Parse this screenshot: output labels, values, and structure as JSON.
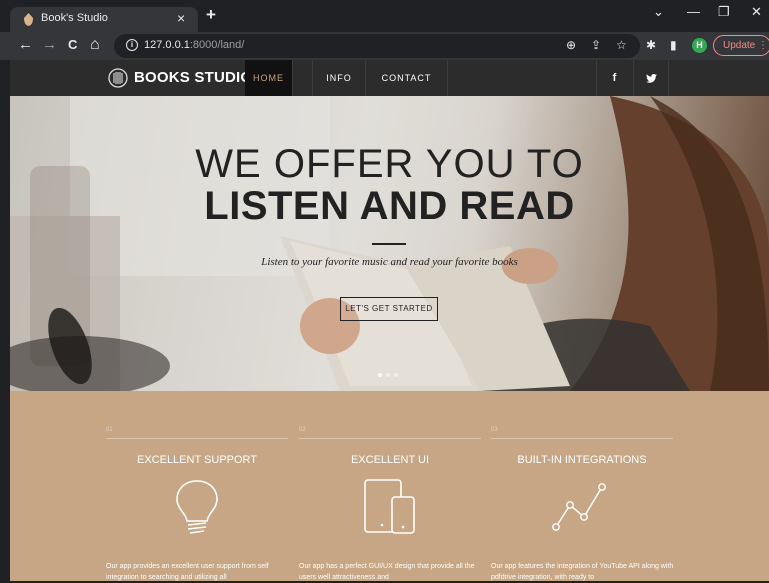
{
  "browser": {
    "tab_title": "Book's Studio",
    "tab_close": "×",
    "new_tab": "+",
    "url_host": "127.0.0.1",
    "url_path": ":8000/land/",
    "update_label": "Update",
    "update_menu": "⋮",
    "profile_initial": "H",
    "window_controls": {
      "dropdown": "⌄",
      "minimize": "—",
      "restore": "❐",
      "close": "✕"
    },
    "nav": {
      "back": "←",
      "forward": "→",
      "reload": "C",
      "home": "⌂"
    },
    "icons": {
      "zoom": "⊕",
      "share": "⇪",
      "bookmark": "☆",
      "extensions": "✱",
      "sidepanel": "▮"
    }
  },
  "site": {
    "brand": "BOOKS STUDIO",
    "nav": [
      "HOME",
      "INFO",
      "CONTACT"
    ],
    "active_nav": "HOME",
    "social": [
      "f",
      "🐦"
    ]
  },
  "hero": {
    "line1": "WE OFFER YOU TO",
    "line2": "LISTEN AND READ",
    "subtitle": "Listen to your favorite music and read your favorite books",
    "cta": "LET'S GET STARTED",
    "slides": 3,
    "active_slide": 0
  },
  "features": [
    {
      "num": "01",
      "title": "EXCELLENT SUPPORT",
      "icon": "lightbulb-icon",
      "text": "Our app provides an excellent user support from self integration to searching and utilizing all"
    },
    {
      "num": "02",
      "title": "EXCELLENT UI",
      "icon": "devices-icon",
      "text": "Our app has a perfect GUI/UX design that provide all the users well attractiveness and"
    },
    {
      "num": "03",
      "title": "BUILT-IN INTEGRATIONS",
      "icon": "graph-icon",
      "text": "Our app features the integration of YouTube API along with pdfdrive integration, with ready to"
    }
  ],
  "colors": {
    "accent": "#c9a57e",
    "feature_bg": "#c6a684",
    "nav_bg": "#2c2c2c"
  }
}
